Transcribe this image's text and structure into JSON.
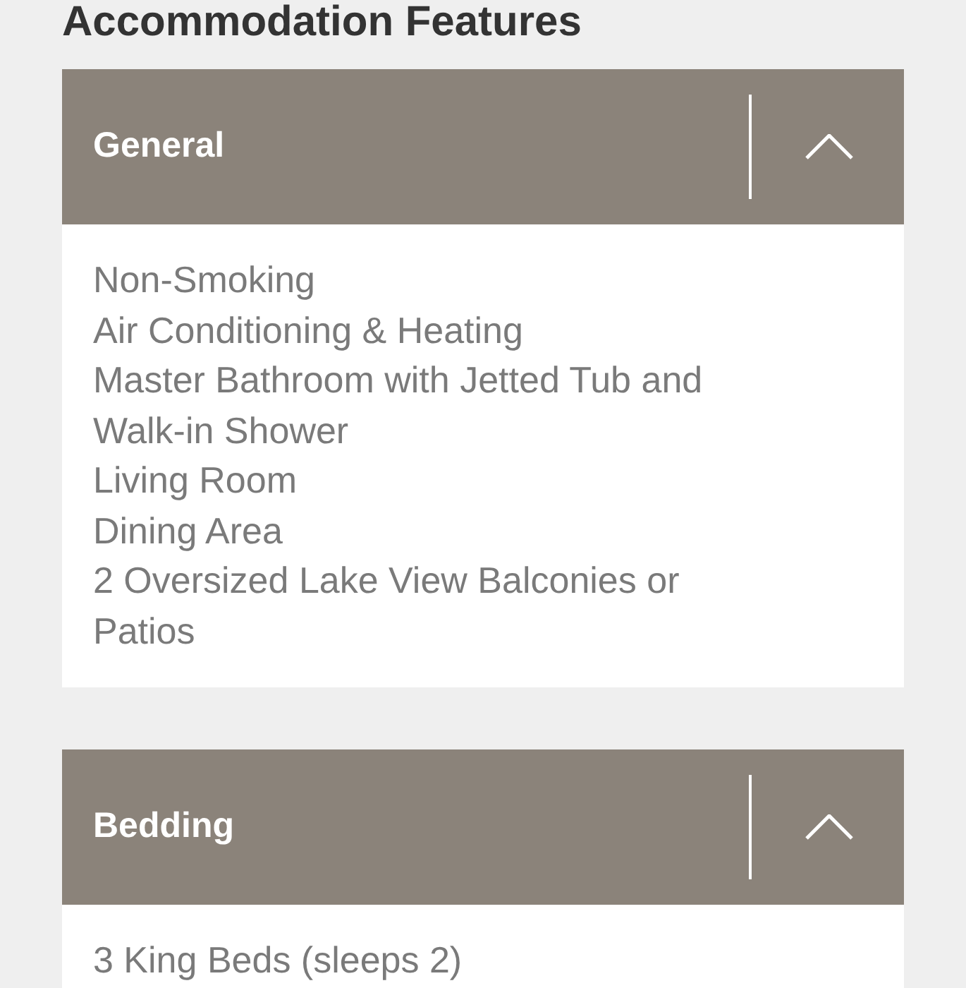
{
  "heading": "Accommodation Features",
  "sections": [
    {
      "title": "General",
      "expanded": true,
      "items": [
        "Non-Smoking",
        "Air Conditioning & Heating",
        "Master Bathroom with Jetted Tub and Walk-in Shower",
        "Living Room",
        "Dining Area",
        "2 Oversized Lake View Balconies or Patios"
      ]
    },
    {
      "title": "Bedding",
      "expanded": true,
      "items": [
        "3 King Beds (sleeps 2)"
      ]
    }
  ]
}
